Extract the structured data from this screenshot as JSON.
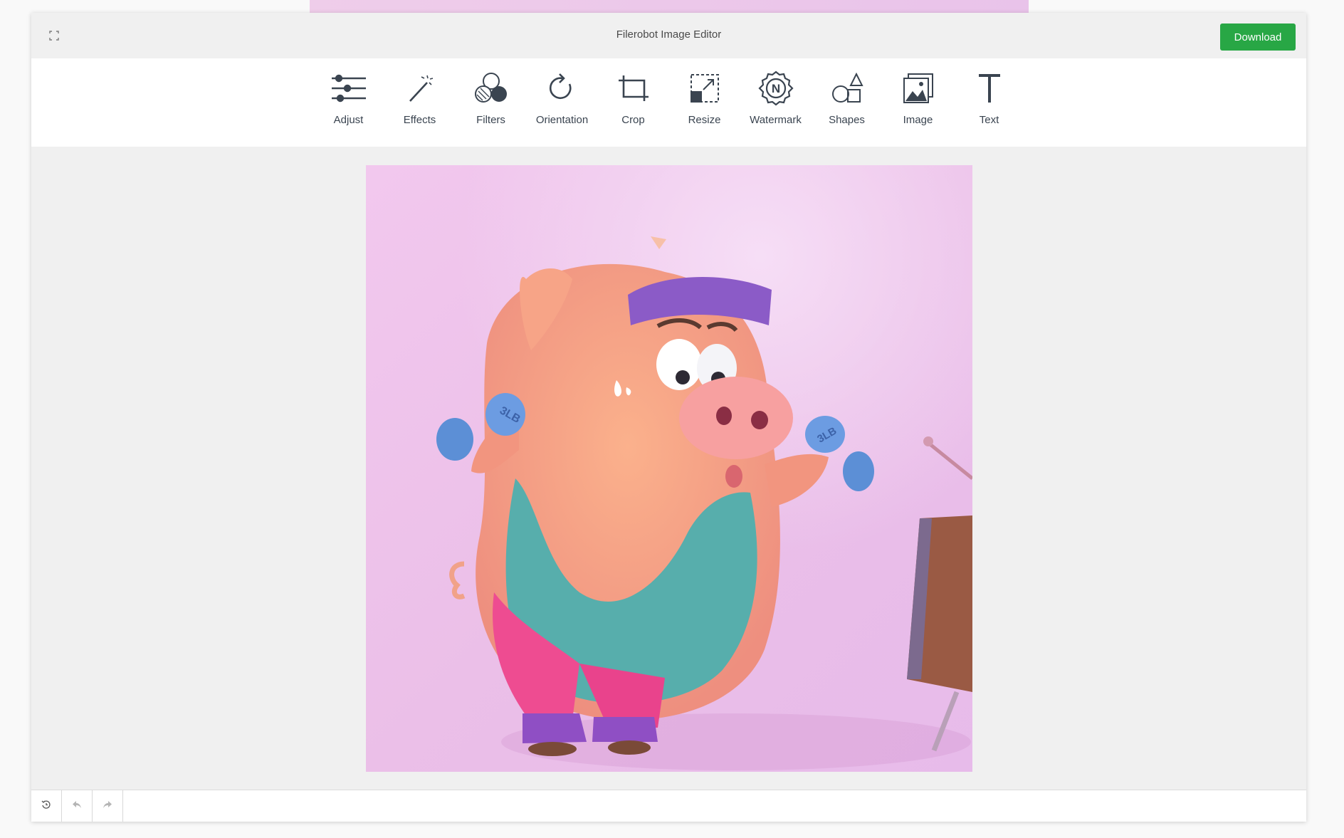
{
  "app": {
    "title": "Filerobot Image Editor",
    "download_label": "Download",
    "accent_color": "#28a745"
  },
  "toolbar": {
    "tools": [
      {
        "label": "Adjust",
        "icon": "sliders-icon"
      },
      {
        "label": "Effects",
        "icon": "magic-wand-icon"
      },
      {
        "label": "Filters",
        "icon": "filters-icon"
      },
      {
        "label": "Orientation",
        "icon": "rotate-icon"
      },
      {
        "label": "Crop",
        "icon": "crop-icon"
      },
      {
        "label": "Resize",
        "icon": "resize-icon"
      },
      {
        "label": "Watermark",
        "icon": "watermark-icon"
      },
      {
        "label": "Shapes",
        "icon": "shapes-icon"
      },
      {
        "label": "Image",
        "icon": "image-icon"
      },
      {
        "label": "Text",
        "icon": "text-icon"
      }
    ]
  },
  "canvas": {
    "image_subject": "cartoon pig lifting dumbbells",
    "dumbbell_text": "3LB"
  },
  "footer": {
    "buttons": [
      "reset-icon",
      "undo-icon",
      "redo-icon"
    ]
  }
}
